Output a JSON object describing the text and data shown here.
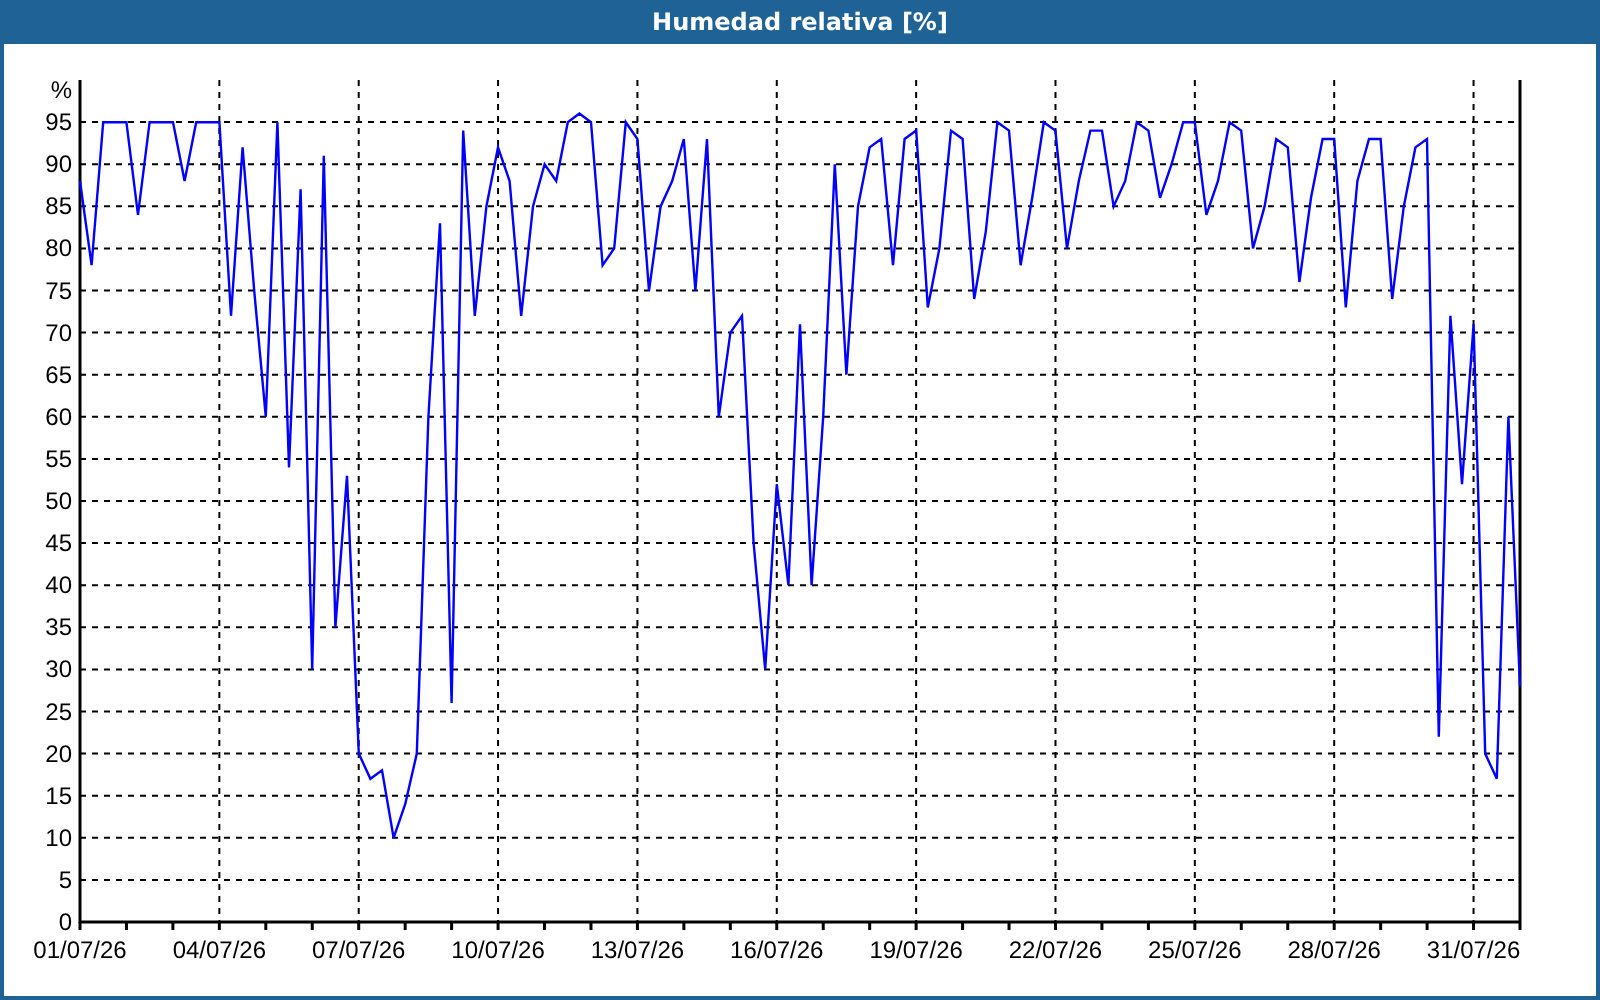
{
  "window": {
    "title": "Humedad relativa [%]"
  },
  "chart_data": {
    "type": "line",
    "grid": true,
    "ylabel": "%",
    "ylim": [
      0,
      100
    ],
    "yticks": [
      0,
      5,
      10,
      15,
      20,
      25,
      30,
      35,
      40,
      45,
      50,
      55,
      60,
      65,
      70,
      75,
      80,
      85,
      90,
      95
    ],
    "categories": [
      "01/07/26",
      null,
      null,
      null,
      null,
      null,
      null,
      null,
      null,
      null,
      null,
      null,
      "04/07/26",
      null,
      null,
      null,
      null,
      null,
      null,
      null,
      null,
      null,
      null,
      null,
      "07/07/26",
      null,
      null,
      null,
      null,
      null,
      null,
      null,
      null,
      null,
      null,
      null,
      "10/07/26",
      null,
      null,
      null,
      null,
      null,
      null,
      null,
      null,
      null,
      null,
      null,
      "13/07/26",
      null,
      null,
      null,
      null,
      null,
      null,
      null,
      null,
      null,
      null,
      null,
      "16/07/26",
      null,
      null,
      null,
      null,
      null,
      null,
      null,
      null,
      null,
      null,
      null,
      "19/07/26",
      null,
      null,
      null,
      null,
      null,
      null,
      null,
      null,
      null,
      null,
      null,
      "22/07/26",
      null,
      null,
      null,
      null,
      null,
      null,
      null,
      null,
      null,
      null,
      null,
      "25/07/26",
      null,
      null,
      null,
      null,
      null,
      null,
      null,
      null,
      null,
      null,
      null,
      "28/07/26",
      null,
      null,
      null,
      null,
      null,
      null,
      null,
      null,
      null,
      null,
      null,
      "31/07/26",
      null,
      null,
      null,
      null
    ],
    "series": [
      {
        "color": "#0000ff",
        "values": [
          88,
          78,
          95,
          95,
          95,
          84,
          95,
          95,
          95,
          88,
          95,
          95,
          95,
          72,
          92,
          75,
          60,
          95,
          54,
          87,
          30,
          91,
          35,
          53,
          20,
          17,
          18,
          10,
          14,
          20,
          60,
          83,
          26,
          94,
          72,
          85,
          92,
          88,
          72,
          85,
          90,
          88,
          95,
          96,
          95,
          78,
          80,
          95,
          93,
          75,
          85,
          88,
          93,
          75,
          93,
          60,
          70,
          72,
          45,
          30,
          52,
          40,
          71,
          40,
          60,
          90,
          65,
          85,
          92,
          93,
          78,
          93,
          94,
          73,
          80,
          94,
          93,
          74,
          82,
          95,
          94,
          78,
          86,
          95,
          94,
          80,
          88,
          94,
          94,
          85,
          88,
          95,
          94,
          86,
          90,
          95,
          95,
          84,
          88,
          95,
          94,
          80,
          85,
          93,
          92,
          76,
          86,
          93,
          93,
          73,
          88,
          93,
          93,
          74,
          85,
          92,
          93,
          22,
          72,
          52,
          71,
          20,
          17,
          60,
          28
        ]
      }
    ]
  }
}
